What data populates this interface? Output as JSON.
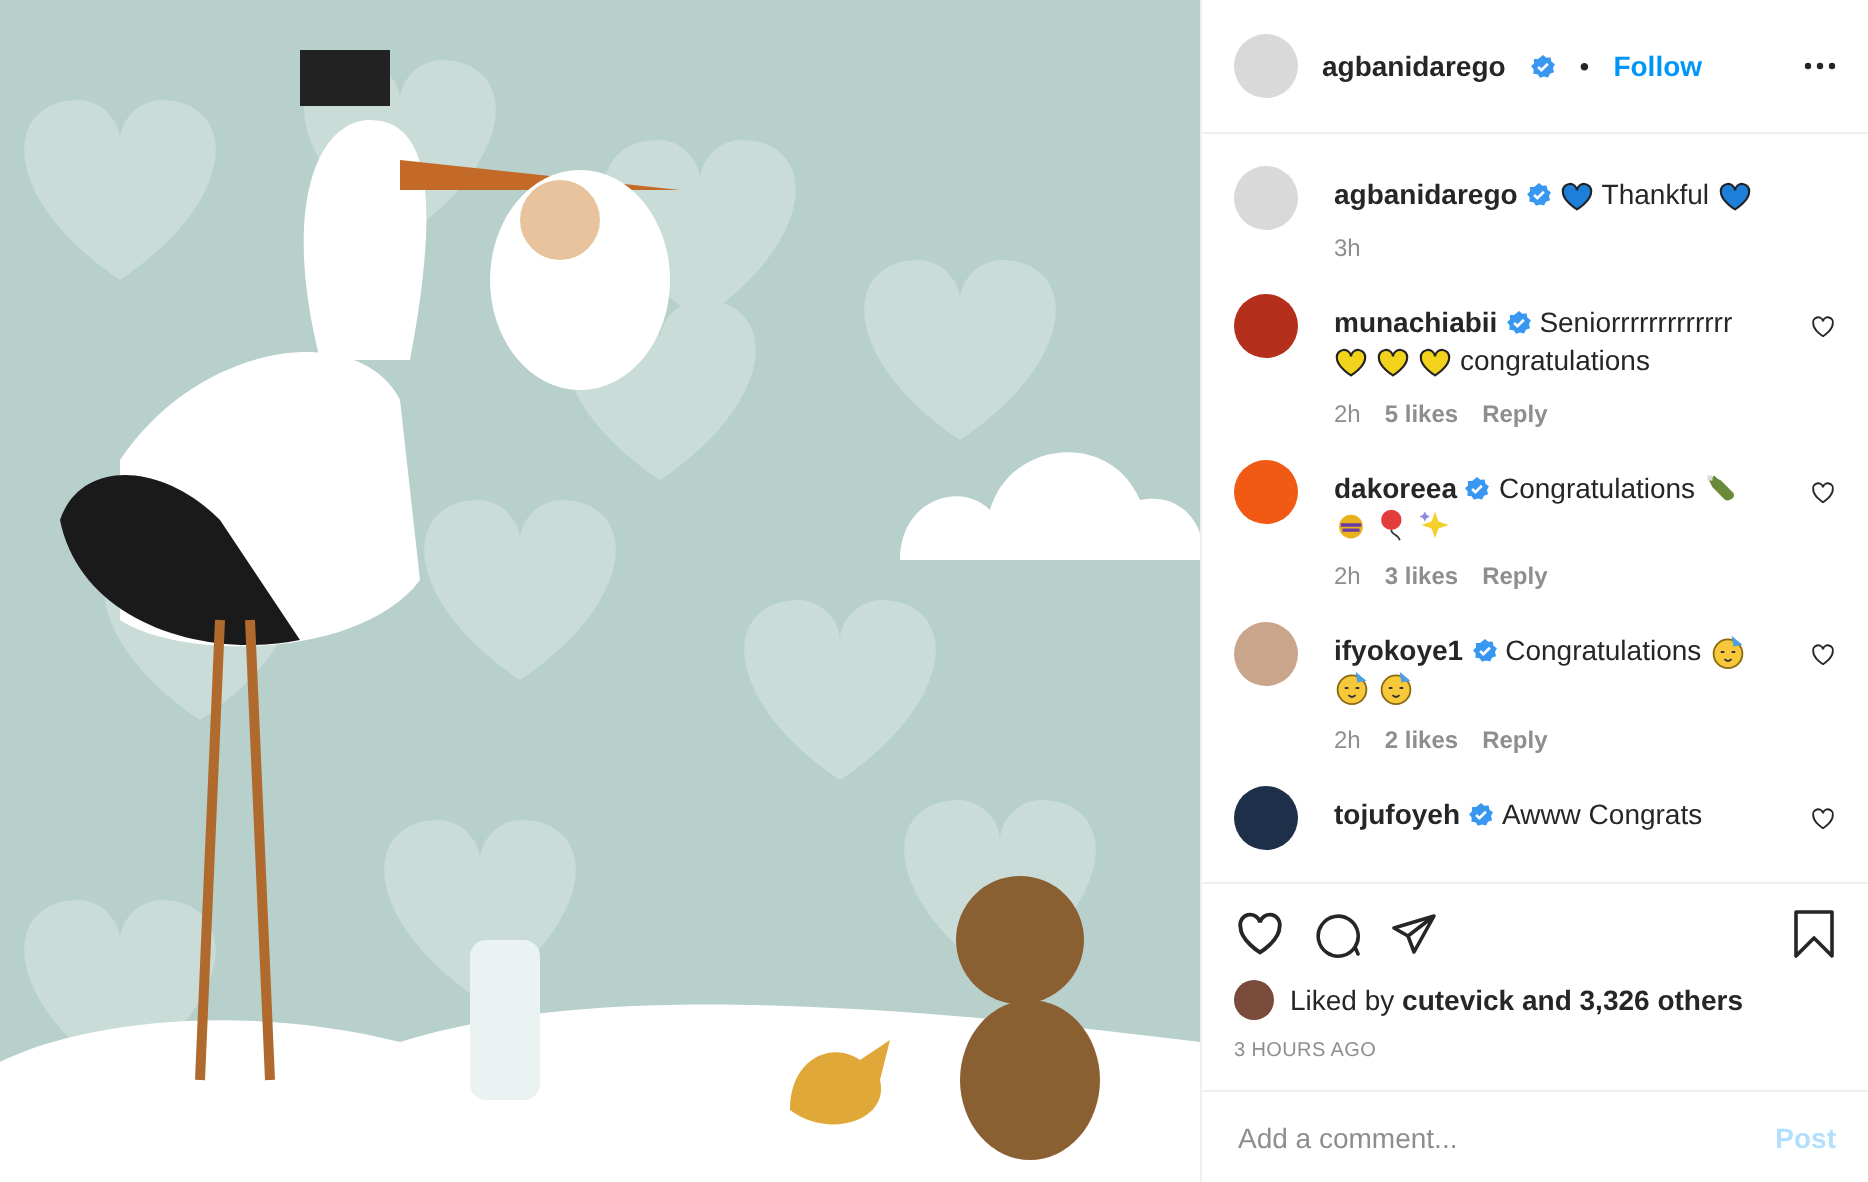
{
  "header": {
    "username": "agbanidarego",
    "verified": true,
    "separator": "•",
    "follow": "Follow"
  },
  "comments": [
    {
      "username": "agbanidarego",
      "verified": true,
      "parts": [
        {
          "kind": "heart",
          "color": "#1d7fd8"
        },
        {
          "kind": "text",
          "value": "Thankful"
        },
        {
          "kind": "heart",
          "color": "#1d7fd8"
        }
      ],
      "time": "3h",
      "like_button": false
    },
    {
      "username": "munachiabii",
      "verified": true,
      "parts": [
        {
          "kind": "text",
          "value": "Seniorrrrrrrrrrrrr"
        },
        {
          "kind": "heart",
          "color": "#f2d21b"
        },
        {
          "kind": "heart",
          "color": "#f2d21b"
        },
        {
          "kind": "heart",
          "color": "#f2d21b"
        },
        {
          "kind": "text",
          "value": "congratulations"
        }
      ],
      "time": "2h",
      "likes": "5 likes",
      "reply": "Reply",
      "like_button": true
    },
    {
      "username": "dakoreea",
      "verified": true,
      "parts": [
        {
          "kind": "text",
          "value": "Congratulations"
        },
        {
          "kind": "bottle"
        },
        {
          "kind": "pinata"
        },
        {
          "kind": "balloon"
        },
        {
          "kind": "sparkles"
        }
      ],
      "time": "2h",
      "likes": "3 likes",
      "reply": "Reply",
      "like_button": true
    },
    {
      "username": "ifyokoye1",
      "verified": true,
      "parts": [
        {
          "kind": "text",
          "value": "Congratulations"
        },
        {
          "kind": "party-face"
        },
        {
          "kind": "party-face"
        },
        {
          "kind": "party-face"
        }
      ],
      "time": "2h",
      "likes": "2 likes",
      "reply": "Reply",
      "like_button": true
    },
    {
      "username": "tojufoyeh",
      "verified": true,
      "parts": [
        {
          "kind": "text",
          "value": "Awww Congrats"
        }
      ],
      "like_button": true
    }
  ],
  "likes": {
    "prefix": "Liked by",
    "user": "cutevick",
    "suffix": "and 3,326 others"
  },
  "timestamp": "3 HOURS AGO",
  "comment_box": {
    "placeholder": "Add a comment...",
    "post": "Post"
  }
}
